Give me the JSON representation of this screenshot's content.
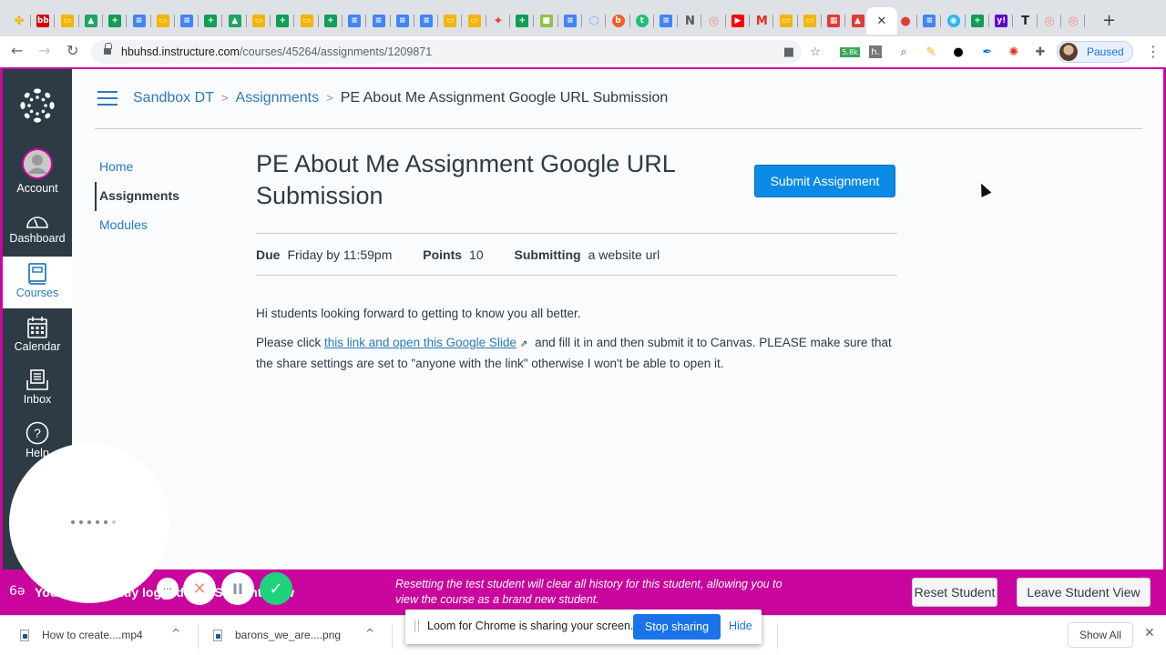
{
  "browser": {
    "tabs": [
      {
        "icon": "google-photos-icon",
        "color": "#f4b400"
      },
      {
        "icon": "bb-icon",
        "color": "#d50000"
      },
      {
        "icon": "google-slides-icon",
        "color": "#f4b400"
      },
      {
        "icon": "google-drive-icon",
        "color": "#1fa463"
      },
      {
        "icon": "google-sheets-icon",
        "color": "#0f9d58"
      },
      {
        "icon": "google-docs-icon",
        "color": "#4285f4"
      },
      {
        "icon": "google-slides-icon",
        "color": "#f4b400"
      },
      {
        "icon": "google-docs-icon",
        "color": "#4285f4"
      },
      {
        "icon": "google-sheets-icon",
        "color": "#0f9d58"
      },
      {
        "icon": "google-drive-icon",
        "color": "#1fa463"
      },
      {
        "icon": "google-slides-icon",
        "color": "#f4b400"
      },
      {
        "icon": "google-sheets-icon",
        "color": "#0f9d58"
      },
      {
        "icon": "google-slides-icon",
        "color": "#f4b400"
      },
      {
        "icon": "google-sheets-icon",
        "color": "#0f9d58"
      },
      {
        "icon": "google-docs-icon",
        "color": "#4285f4"
      },
      {
        "icon": "google-docs-icon",
        "color": "#4285f4"
      },
      {
        "icon": "google-docs-icon",
        "color": "#4285f4"
      },
      {
        "icon": "google-docs-icon",
        "color": "#4285f4"
      },
      {
        "icon": "google-slides-icon",
        "color": "#f4b400"
      },
      {
        "icon": "google-slides-icon",
        "color": "#f4b400"
      },
      {
        "icon": "pinwheel-icon",
        "color": "#e94235"
      },
      {
        "icon": "google-sheets-icon",
        "color": "#0f9d58"
      },
      {
        "icon": "colorful-square-icon",
        "color": "#8bc34a"
      },
      {
        "icon": "google-docs-icon",
        "color": "#4285f4"
      },
      {
        "icon": "hexagons-icon",
        "color": "#7fb3e0"
      },
      {
        "icon": "bitly-icon",
        "color": "#ee6123"
      },
      {
        "icon": "teal-circle-icon",
        "color": "#1dbf73"
      },
      {
        "icon": "google-docs-icon",
        "color": "#4285f4"
      },
      {
        "icon": "news-icon",
        "color": "#555555"
      },
      {
        "icon": "swirl-icon",
        "color": "#f28b82"
      },
      {
        "icon": "youtube-icon",
        "color": "#ff0000"
      },
      {
        "icon": "gmail-icon",
        "color": "#d93025"
      },
      {
        "icon": "google-slides-icon",
        "color": "#f4b400"
      },
      {
        "icon": "google-slides-icon",
        "color": "#f4b400"
      },
      {
        "icon": "clapper-icon",
        "color": "#e53935"
      },
      {
        "icon": "image-icon",
        "color": "#e53935"
      },
      {
        "icon": "close-icon",
        "color": "#3c4043",
        "active": true
      },
      {
        "icon": "record-icon",
        "color": "#e53935"
      },
      {
        "icon": "google-docs-icon",
        "color": "#4285f4"
      },
      {
        "icon": "bottle-icon",
        "color": "#29b6f6"
      },
      {
        "icon": "google-sheets-icon",
        "color": "#0f9d58"
      },
      {
        "icon": "yahoo-icon",
        "color": "#6001d2"
      },
      {
        "icon": "nyt-icon",
        "color": "#222222"
      },
      {
        "icon": "swirl-icon",
        "color": "#f28b82"
      },
      {
        "icon": "swirl-icon",
        "color": "#f28b82"
      }
    ],
    "new_tab": "+",
    "url_host": "hbuhsd.instructure.com",
    "url_path": "/courses/45264/assignments/1209871",
    "extension_badge": "5.8k",
    "profile_label": "Paused"
  },
  "global_nav": {
    "account": "Account",
    "dashboard": "Dashboard",
    "courses": "Courses",
    "calendar": "Calendar",
    "inbox": "Inbox",
    "help": "Help"
  },
  "breadcrumb": {
    "course": "Sandbox DT",
    "section": "Assignments",
    "current": "PE About Me Assignment Google URL Submission"
  },
  "course_nav": [
    {
      "label": "Home",
      "active": false
    },
    {
      "label": "Assignments",
      "active": true
    },
    {
      "label": "Modules",
      "active": false
    }
  ],
  "assignment": {
    "title": "PE About Me Assignment Google URL Submission",
    "submit_label": "Submit Assignment",
    "due_label": "Due",
    "due_value": "Friday by 11:59pm",
    "points_label": "Points",
    "points_value": "10",
    "submitting_label": "Submitting",
    "submitting_value": "a website url",
    "desc_p1": "Hi students looking forward to getting to know you all better.",
    "desc_p2_before": "Please click ",
    "desc_p2_link": "this link and open this Google Slide",
    "desc_p2_after": " and fill it in and then submit it to Canvas. PLEASE make sure that the share settings are set to \"anyone with the link\" otherwise I won't be able to open it."
  },
  "student_view": {
    "message": "You are currently logged into Student View",
    "note": "Resetting the test student will clear all history for this student, allowing you to view the course as a brand new student.",
    "reset_label": "Reset Student",
    "leave_label": "Leave Student View"
  },
  "loom": {
    "share_text": "Loom for Chrome is sharing your screen.",
    "stop_label": "Stop sharing",
    "hide_label": "Hide"
  },
  "downloads": {
    "items": [
      {
        "name": "How to create....mp4"
      },
      {
        "name": "barons_we_are....png"
      }
    ],
    "show_all": "Show All"
  },
  "colors": {
    "student_view_accent": "#c9059d",
    "canvas_blue": "#0b8ae6",
    "nav_dark": "#2d3b45"
  }
}
